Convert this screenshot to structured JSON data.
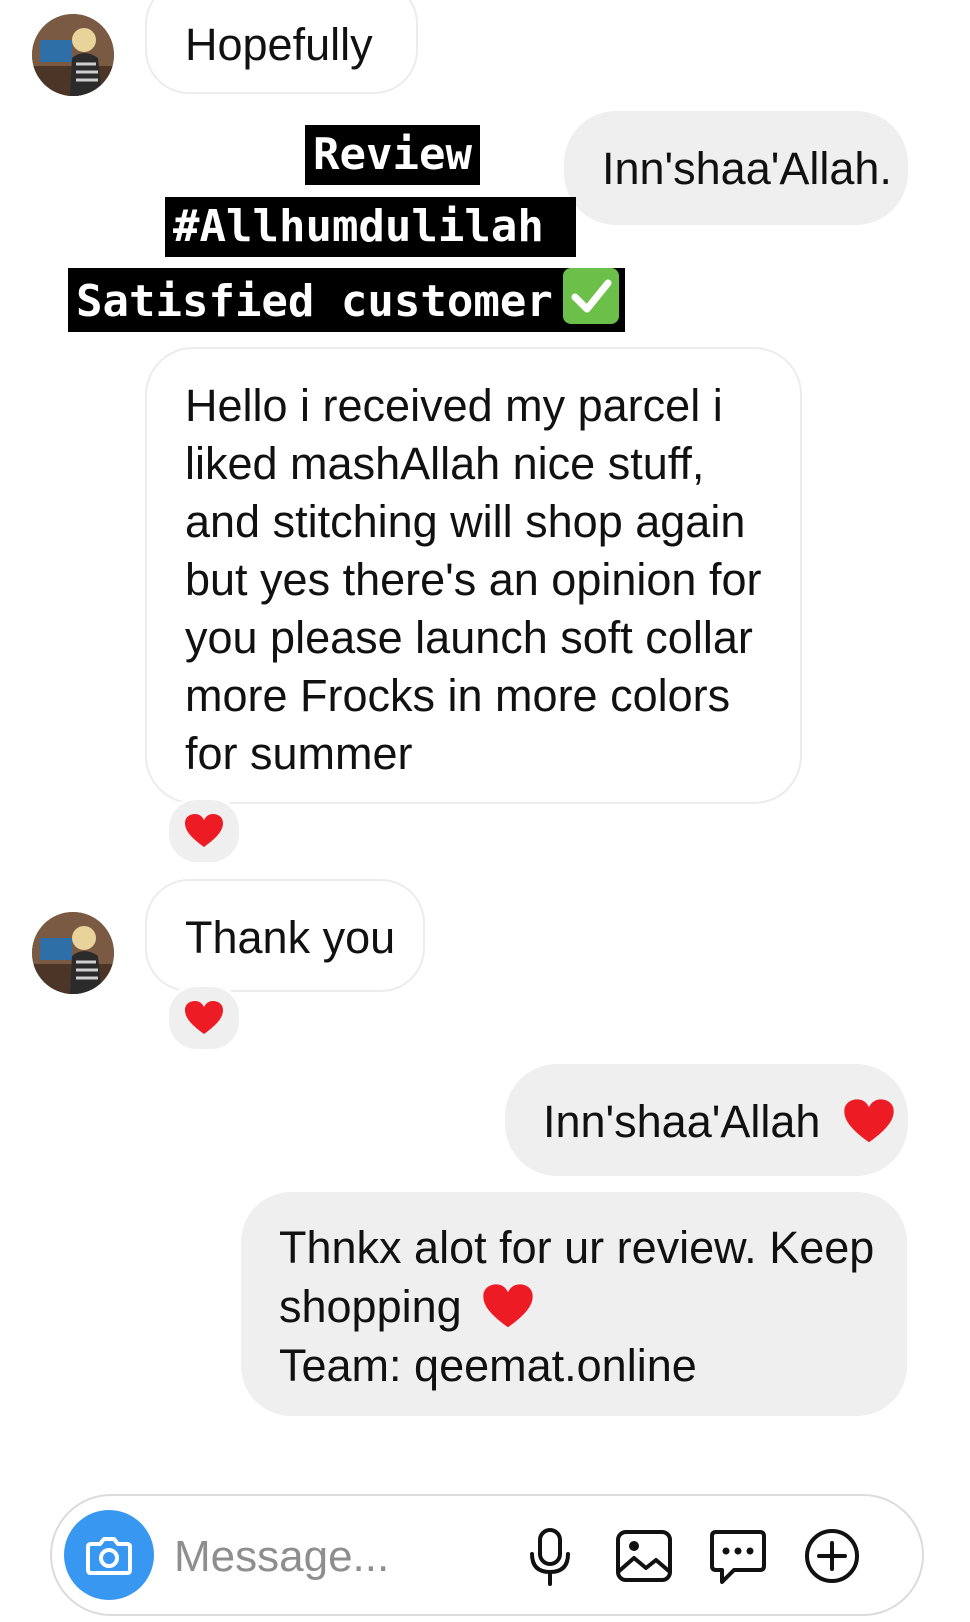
{
  "thread": {
    "first_incoming": {
      "text": "Hopefully"
    },
    "outgoing_1": {
      "text": "Inn'shaa'Allah."
    },
    "overlay": {
      "line1": "Review",
      "line2": "#Allhumdulilah",
      "line3": "Satisfied customer"
    },
    "review_message": {
      "lines": [
        "Hello i received my parcel i",
        "liked mashAllah nice stuff,",
        "and stitching will shop again",
        "but yes there's an opinion for",
        "you please launch soft collar",
        "more Frocks in more colors",
        "for summer"
      ],
      "reaction": "heart"
    },
    "thank_you": {
      "text": "Thank you",
      "reaction": "heart"
    },
    "outgoing_2": {
      "text": "Inn'shaa'Allah"
    },
    "outgoing_3": {
      "line1": "Thnkx alot for ur review. Keep",
      "line2": "shopping",
      "line3": "Team: qeemat.online"
    }
  },
  "composer": {
    "placeholder": "Message...",
    "icons": [
      "camera-icon",
      "microphone-icon",
      "gallery-icon",
      "sticker-icon",
      "plus-icon"
    ]
  },
  "colors": {
    "camera_blue": "#3897f0",
    "outgoing_bubble": "#efefef",
    "incoming_border": "#ececec",
    "heart_red": "#ed1c24",
    "check_green": "#6cc04a"
  }
}
